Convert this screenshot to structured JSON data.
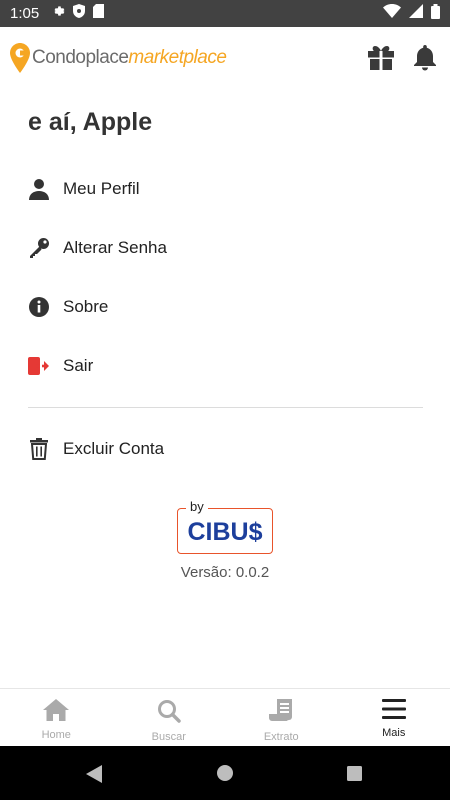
{
  "status_bar": {
    "time": "1:05"
  },
  "header": {
    "brand": "Condoplace",
    "brand_suffix": "marketplace",
    "accent_color": "#f5a623"
  },
  "greeting": "e aí, Apple",
  "menu": [
    {
      "label": "Meu Perfil",
      "icon": "person-icon"
    },
    {
      "label": "Alterar Senha",
      "icon": "key-icon"
    },
    {
      "label": "Sobre",
      "icon": "info-icon"
    },
    {
      "label": "Sair",
      "icon": "logout-icon",
      "color": "#e53935"
    },
    {
      "label": "Excluir Conta",
      "icon": "trash-icon"
    }
  ],
  "footer": {
    "by": "by",
    "partner": "CIBU$",
    "partner_color": "#1d3f9c",
    "version": "Versão: 0.0.2"
  },
  "bottom_nav": [
    {
      "label": "Home",
      "icon": "home-icon",
      "active": false
    },
    {
      "label": "Buscar",
      "icon": "search-icon",
      "active": false
    },
    {
      "label": "Extrato",
      "icon": "receipt-icon",
      "active": false
    },
    {
      "label": "Mais",
      "icon": "menu-icon",
      "active": true
    }
  ]
}
